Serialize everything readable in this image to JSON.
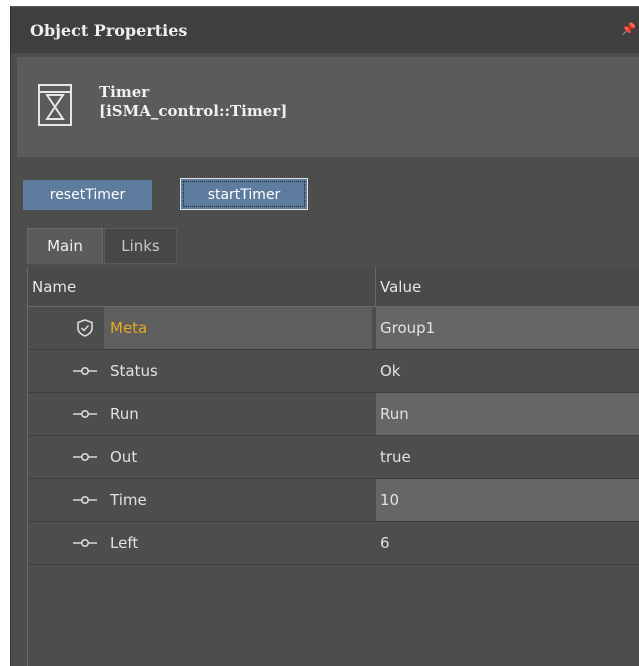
{
  "panel": {
    "title": "Object Properties",
    "pin_glyph": "ᵖ"
  },
  "object": {
    "icon": "hourglass-icon",
    "name": "Timer",
    "type": "[iSMA_control::Timer]"
  },
  "actions": {
    "reset_label": "resetTimer",
    "start_label": "startTimer"
  },
  "tabs": {
    "main": "Main",
    "links": "Links"
  },
  "grid": {
    "col_name": "Name",
    "col_value": "Value",
    "rows": [
      {
        "name": "Meta",
        "value": "Group1",
        "icon": "shield-check-icon",
        "selected": true
      },
      {
        "name": "Status",
        "value": "Ok",
        "icon": "slot-pin-icon"
      },
      {
        "name": "Run",
        "value": "Run",
        "icon": "slot-pin-icon"
      },
      {
        "name": "Out",
        "value": "true",
        "icon": "slot-pin-icon"
      },
      {
        "name": "Time",
        "value": "10",
        "icon": "slot-pin-icon"
      },
      {
        "name": "Left",
        "value": "6",
        "icon": "slot-pin-icon"
      }
    ]
  },
  "colors": {
    "accent_button": "#5e7d9e",
    "selected_text": "#e8a823",
    "panel_bg": "#4d4d4d"
  }
}
